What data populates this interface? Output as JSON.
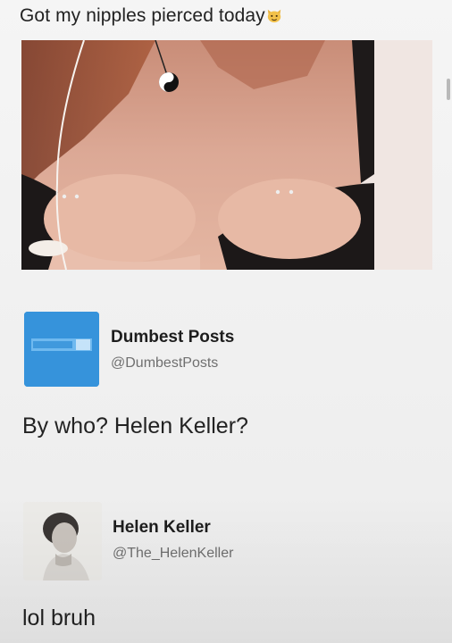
{
  "post": {
    "caption": "Got my nipples pierced today",
    "emoji_icon": "cat-face-icon",
    "image_icon": "photo-icon"
  },
  "replies": [
    {
      "display_name": "Dumbest Posts",
      "handle": "@DumbestPosts",
      "avatar_icon": "dumbest-posts-logo-icon",
      "avatar_color": "#2f8fd8",
      "text": "By who?  Helen Keller?"
    },
    {
      "display_name": "Helen Keller",
      "handle": "@The_HelenKeller",
      "avatar_icon": "portrait-icon",
      "text": "lol bruh"
    }
  ],
  "colors": {
    "background": "#f3f3f3",
    "text": "#1a1a1a",
    "handle": "#6f6f6f"
  }
}
